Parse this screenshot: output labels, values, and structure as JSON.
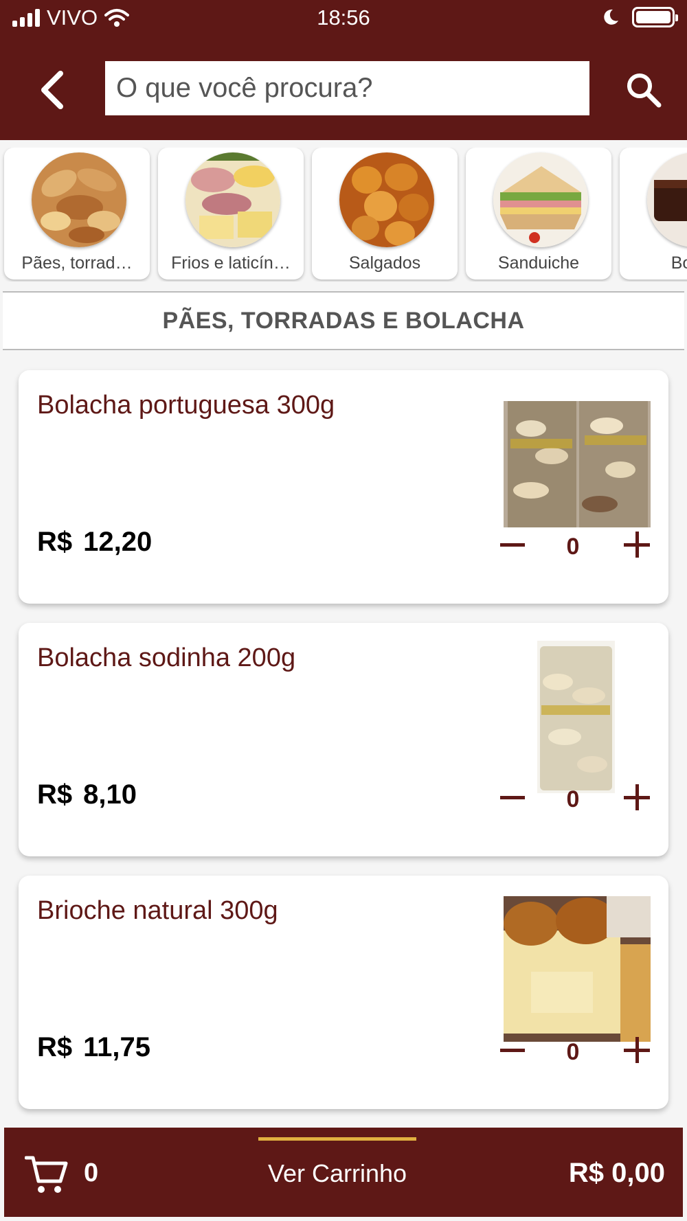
{
  "status_bar": {
    "carrier": "VIVO",
    "time": "18:56"
  },
  "header": {
    "search_placeholder": "O que você procura?",
    "icons": [
      "chevron-left-icon",
      "search-icon"
    ]
  },
  "categories": [
    {
      "label": "Pães, torrad…",
      "image": "bread-basket-photo"
    },
    {
      "label": "Frios e laticín…",
      "image": "cold-cuts-photo"
    },
    {
      "label": "Salgados",
      "image": "fried-snacks-photo"
    },
    {
      "label": "Sanduiche",
      "image": "sandwich-photo"
    },
    {
      "label": "Bolos",
      "image": "cakes-photo"
    }
  ],
  "section": {
    "title": "PÃES, TORRADAS E BOLACHA"
  },
  "products": [
    {
      "name": "Bolacha portuguesa 300g",
      "currency": "R$",
      "price": "12,20",
      "quantity": "0"
    },
    {
      "name": "Bolacha sodinha 200g",
      "currency": "R$",
      "price": "8,10",
      "quantity": "0"
    },
    {
      "name": "Brioche natural 300g",
      "currency": "R$",
      "price": "11,75",
      "quantity": "0"
    }
  ],
  "cart": {
    "count": "0",
    "view_label": "Ver Carrinho",
    "total": "R$ 0,00"
  },
  "colors": {
    "brand": "#5e1816",
    "accent": "#e0b040",
    "background": "#f5f5f5"
  }
}
